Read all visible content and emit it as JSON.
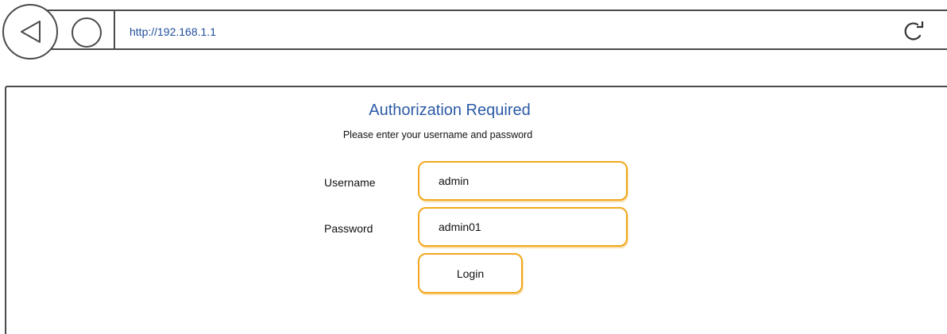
{
  "browser": {
    "url": "http://192.168.1.1",
    "back_icon": "back-arrow-icon",
    "home_icon": "circle-home-icon",
    "reload_icon": "reload-icon"
  },
  "auth": {
    "title": "Authorization Required",
    "subtitle": "Please enter your username and password",
    "username_label": "Username",
    "username_value": "admin",
    "password_label": "Password",
    "password_value": "admin01",
    "login_label": "Login"
  },
  "colors": {
    "accent": "#f2a81d",
    "title": "#2b5aa6",
    "url": "#1f4e9c",
    "chrome_stroke": "#4a4a4a"
  }
}
